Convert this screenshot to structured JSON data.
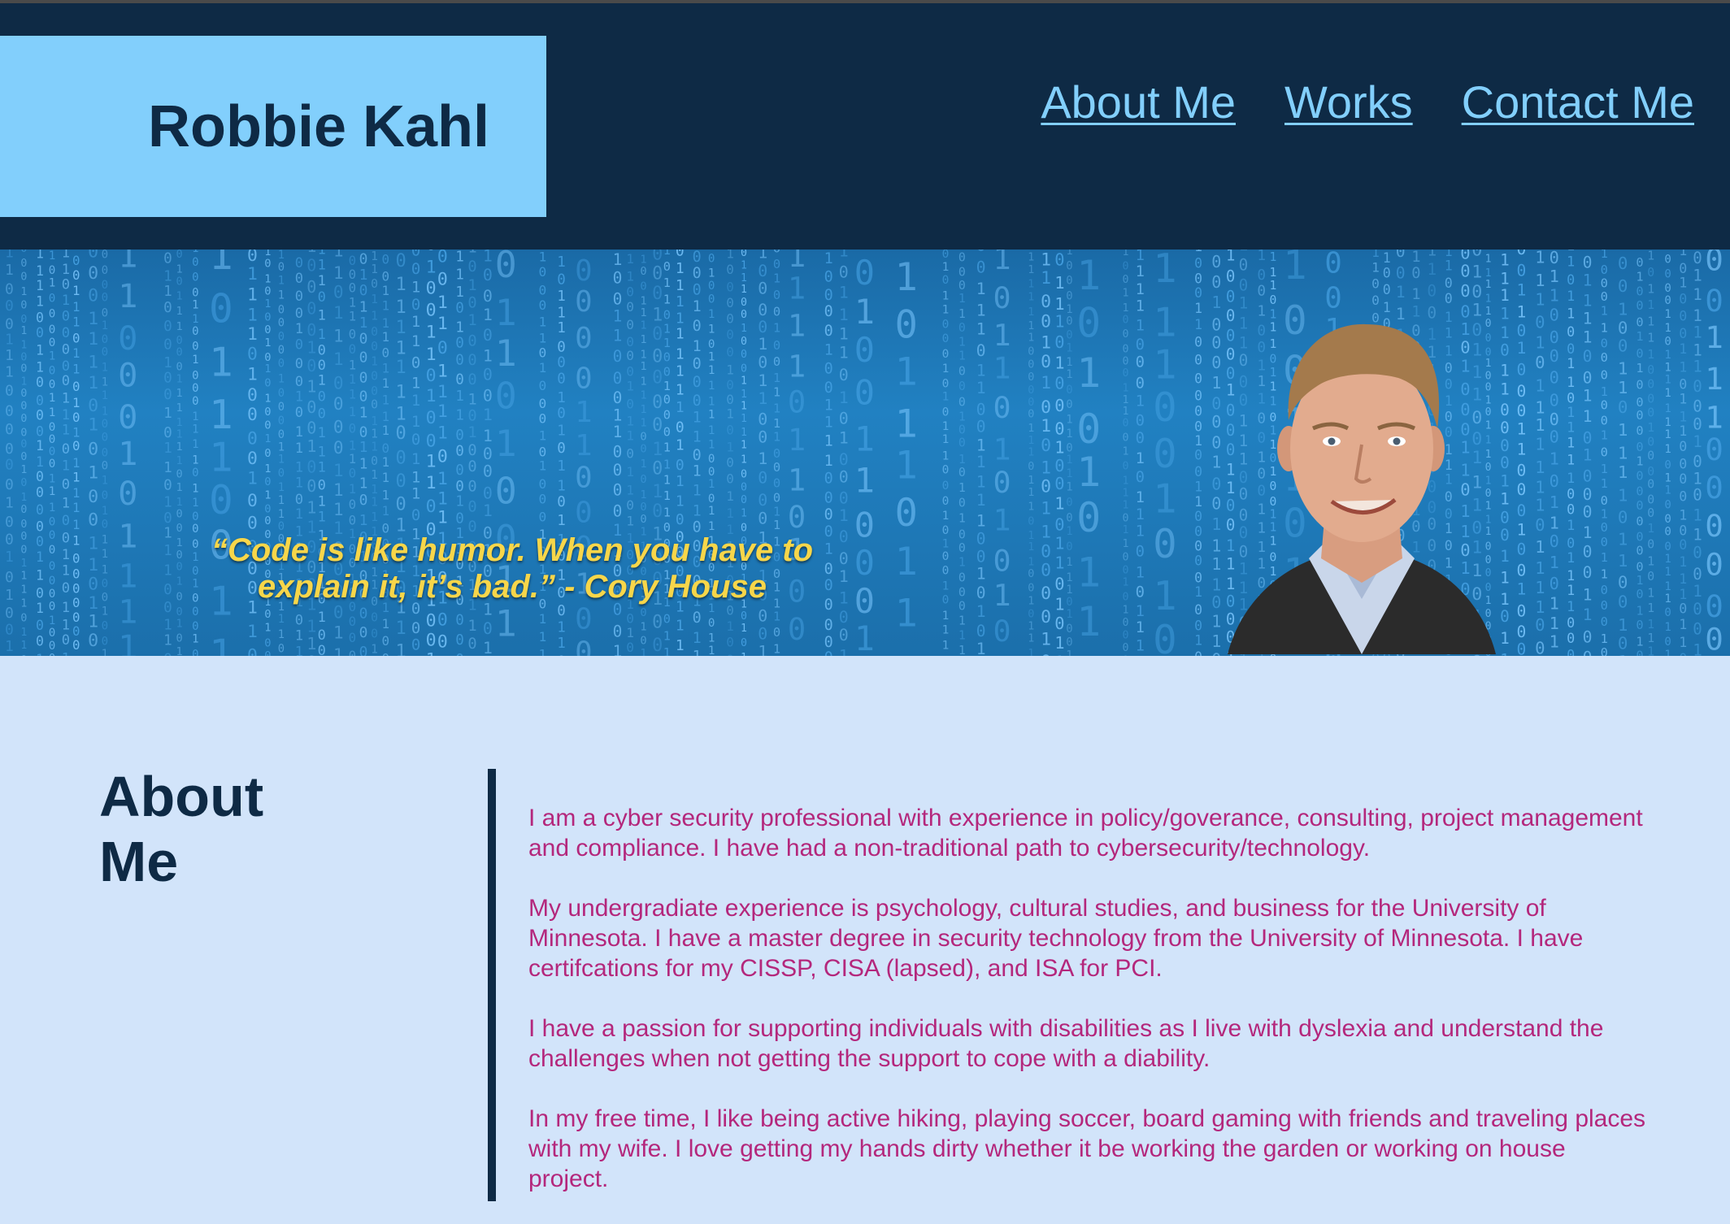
{
  "header": {
    "brand": "Robbie Kahl",
    "nav": [
      {
        "label": "About Me"
      },
      {
        "label": "Works"
      },
      {
        "label": "Contact Me"
      }
    ]
  },
  "hero": {
    "quote": "“Code is like humor. When you have to explain it, it’s bad.” - Cory House",
    "background": "binary-matrix-pattern",
    "portrait": "profile-photo"
  },
  "about": {
    "heading": "About Me",
    "paragraphs": [
      "I am a cyber security professional with experience in policy/goverance, consulting, project management and compliance. I have had a non-traditional path to cybersecurity/technology.",
      "My undergradiate experience is psychology, cultural studies, and business for the University of Minnesota. I have a master degree in security technology from the University of Minnesota. I have certifcations for my CISSP, CISA (lapsed), and ISA for PCI.",
      "I have a passion for supporting individuals with disabilities as I live with dyslexia and understand the challenges when not getting the support to cope with a diability.",
      "In my free time, I like being active hiking, playing soccer, board gaming with friends and traveling places with my wife. I love getting my hands dirty whether it be working the garden or working on house project."
    ]
  },
  "colors": {
    "header_bg": "#0e2a45",
    "brand_bg": "#82cffc",
    "nav_link": "#82cffc",
    "page_bg": "#d2e4fa",
    "quote": "#f7d64a",
    "body_text": "#b4277c"
  }
}
